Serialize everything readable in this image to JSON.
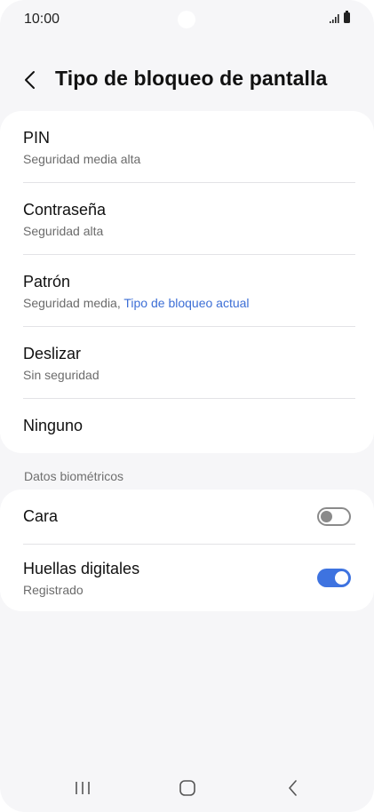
{
  "status_bar": {
    "time": "10:00",
    "icons": [
      "signal-icon",
      "battery-icon"
    ]
  },
  "header": {
    "back_icon": "chevron-left-icon",
    "title": "Tipo de bloqueo de pantalla"
  },
  "lock_options": [
    {
      "title": "PIN",
      "subtitle": "Seguridad media alta"
    },
    {
      "title": "Contraseña",
      "subtitle": "Seguridad alta"
    },
    {
      "title": "Patrón",
      "subtitle": "Seguridad media, ",
      "subtitle_accent": "Tipo de bloqueo actual"
    },
    {
      "title": "Deslizar",
      "subtitle": "Sin seguridad"
    },
    {
      "title": "Ninguno"
    }
  ],
  "biometrics": {
    "section_label": "Datos biométricos",
    "items": [
      {
        "title": "Cara",
        "toggle": "off"
      },
      {
        "title": "Huellas digitales",
        "subtitle": "Registrado",
        "toggle": "on"
      }
    ]
  },
  "colors": {
    "accent": "#3d6fd6",
    "toggle_on": "#3e73e0",
    "background": "#f6f6f8"
  },
  "nav_bar": {
    "buttons": [
      "recents-icon",
      "home-icon",
      "back-icon"
    ]
  }
}
